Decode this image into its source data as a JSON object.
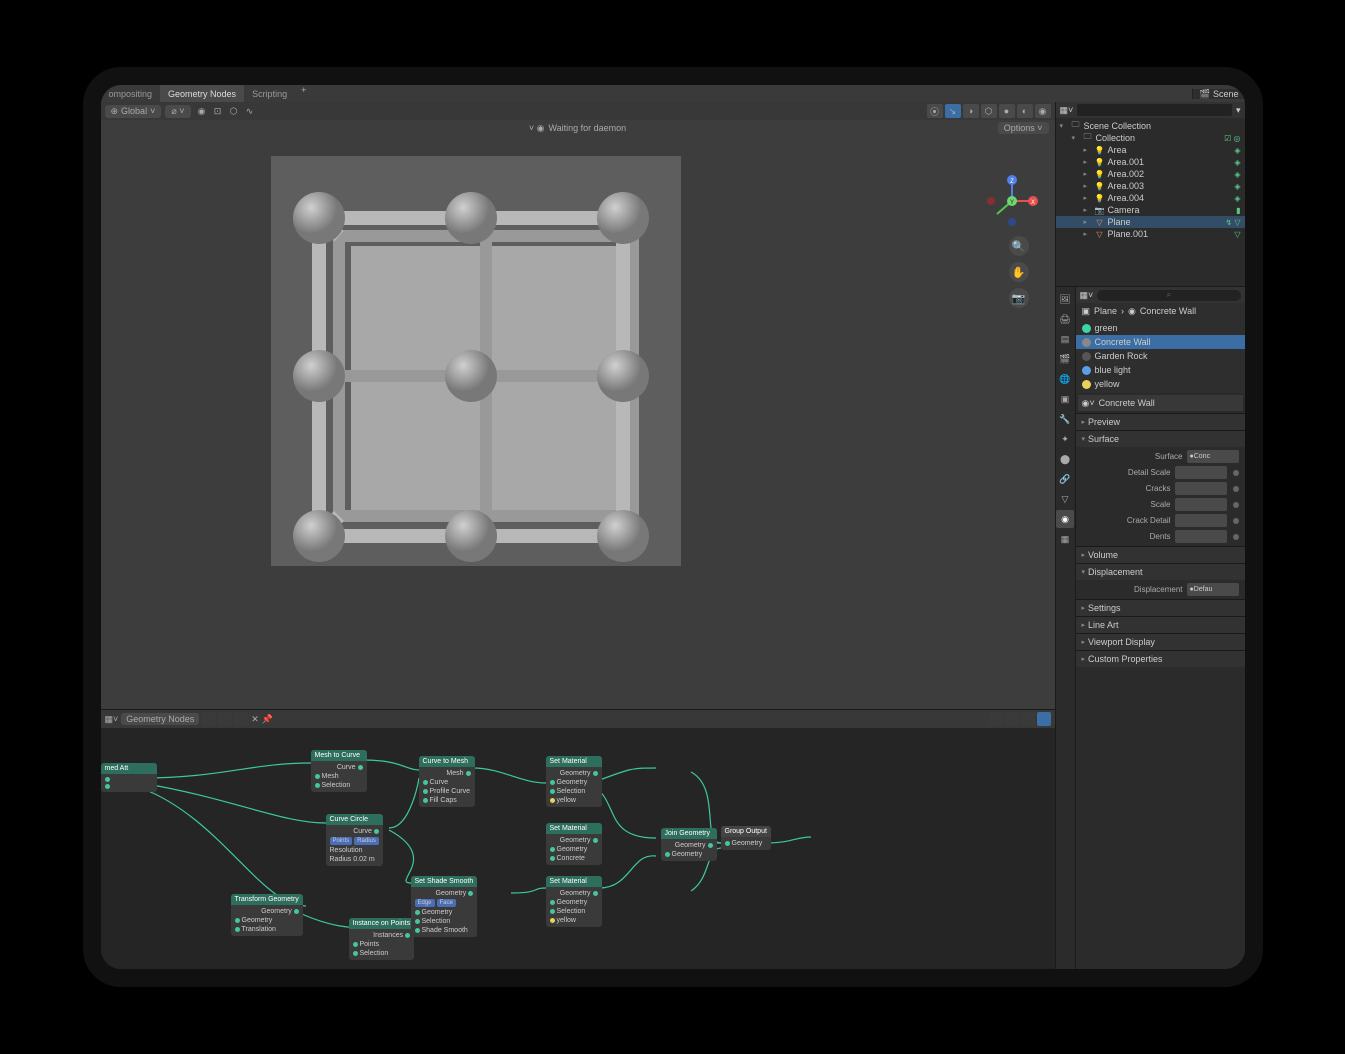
{
  "top_tabs": {
    "compositing": "ompositing",
    "geometry_nodes": "Geometry Nodes",
    "scripting": "Scripting"
  },
  "scene_name": "Scene",
  "viewport": {
    "orientation": "Global",
    "status": "Waiting for daemon",
    "options_label": "Options"
  },
  "outliner": {
    "root": "Scene Collection",
    "collection": "Collection",
    "items": [
      {
        "name": "Area",
        "type": "light"
      },
      {
        "name": "Area.001",
        "type": "light"
      },
      {
        "name": "Area.002",
        "type": "light"
      },
      {
        "name": "Area.003",
        "type": "light"
      },
      {
        "name": "Area.004",
        "type": "light"
      },
      {
        "name": "Camera",
        "type": "cam"
      },
      {
        "name": "Plane",
        "type": "plane",
        "sel": true
      },
      {
        "name": "Plane.001",
        "type": "plane"
      }
    ]
  },
  "breadcrumb": {
    "obj": "Plane",
    "mat": "Concrete Wall"
  },
  "materials": [
    {
      "name": "green",
      "color": "#3fd4a8"
    },
    {
      "name": "Concrete Wall",
      "color": "#888",
      "sel": true
    },
    {
      "name": "Garden Rock",
      "color": "#555"
    },
    {
      "name": "blue light",
      "color": "#5aa0e8"
    },
    {
      "name": "yellow",
      "color": "#e8d25a"
    }
  ],
  "material_field": "Concrete Wall",
  "panels": {
    "preview": "Preview",
    "surface": "Surface",
    "surface_label": "Surface",
    "surface_value": "Conc",
    "detail_scale": "Detail Scale",
    "cracks": "Cracks",
    "scale": "Scale",
    "crack_detail": "Crack Detail",
    "dents": "Dents",
    "volume": "Volume",
    "displacement": "Displacement",
    "displacement_label": "Displacement",
    "displacement_value": "Defau",
    "settings": "Settings",
    "line_art": "Line Art",
    "viewport_display": "Viewport Display",
    "custom_properties": "Custom Properties"
  },
  "node_editor": {
    "title": "Geometry Nodes",
    "nodes": {
      "named_attr": "med Att",
      "mesh_to_curve": "Mesh to Curve",
      "curve_to_mesh": "Curve to Mesh",
      "curve_circle": "Curve Circle",
      "transform": "Transform Geometry",
      "instance": "Instance on Points",
      "set_shade": "Set Shade Smooth",
      "set_material": "Set Material",
      "set_material2": "Set Material",
      "set_material3": "Set Material",
      "join_geometry": "Join Geometry",
      "group_output": "Group Output",
      "curve_lbl": "Curve",
      "mesh_lbl": "Mesh",
      "selection": "Selection",
      "geometry": "Geometry",
      "profile": "Profile Curve",
      "fill_caps": "Fill Caps",
      "points": "Points",
      "radius": "Radius",
      "resolution": "Resolution",
      "translation": "Translation",
      "instances": "Instances",
      "edge": "Edge",
      "face": "Face",
      "shade_smooth": "Shade Smooth",
      "material": "Material",
      "concrete": "Concrete",
      "yellow": "yellow"
    }
  }
}
